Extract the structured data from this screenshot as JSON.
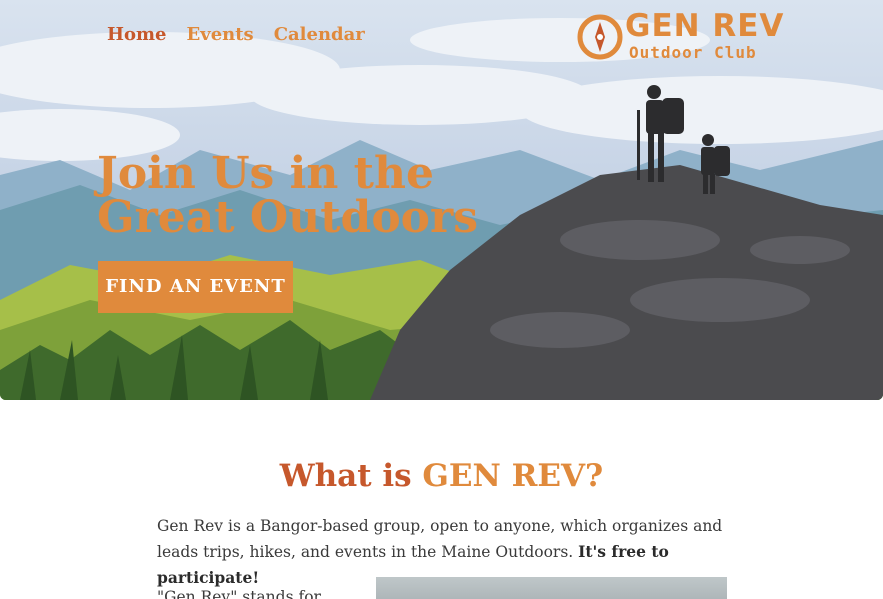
{
  "nav": {
    "items": [
      {
        "label": "Home"
      },
      {
        "label": "Events"
      },
      {
        "label": "Calendar"
      }
    ]
  },
  "logo": {
    "title": "GEN REV",
    "subtitle": "Outdoor Club"
  },
  "hero": {
    "headline_line1": "Join Us in the",
    "headline_line2": "Great Outdoors",
    "cta_label": "FIND AN EVENT"
  },
  "about": {
    "title_prefix": "What is ",
    "title_accent": "GEN REV?",
    "intro_text": "Gen Rev is a Bangor-based group, open to anyone, which organizes and leads trips, hikes, and events in the Maine Outdoors. ",
    "intro_bold": "It's free to participate!",
    "column_text": "\"Gen Rev\" stands for"
  },
  "colors": {
    "accent": "#e08a3c",
    "accent_dark": "#c6582c"
  }
}
